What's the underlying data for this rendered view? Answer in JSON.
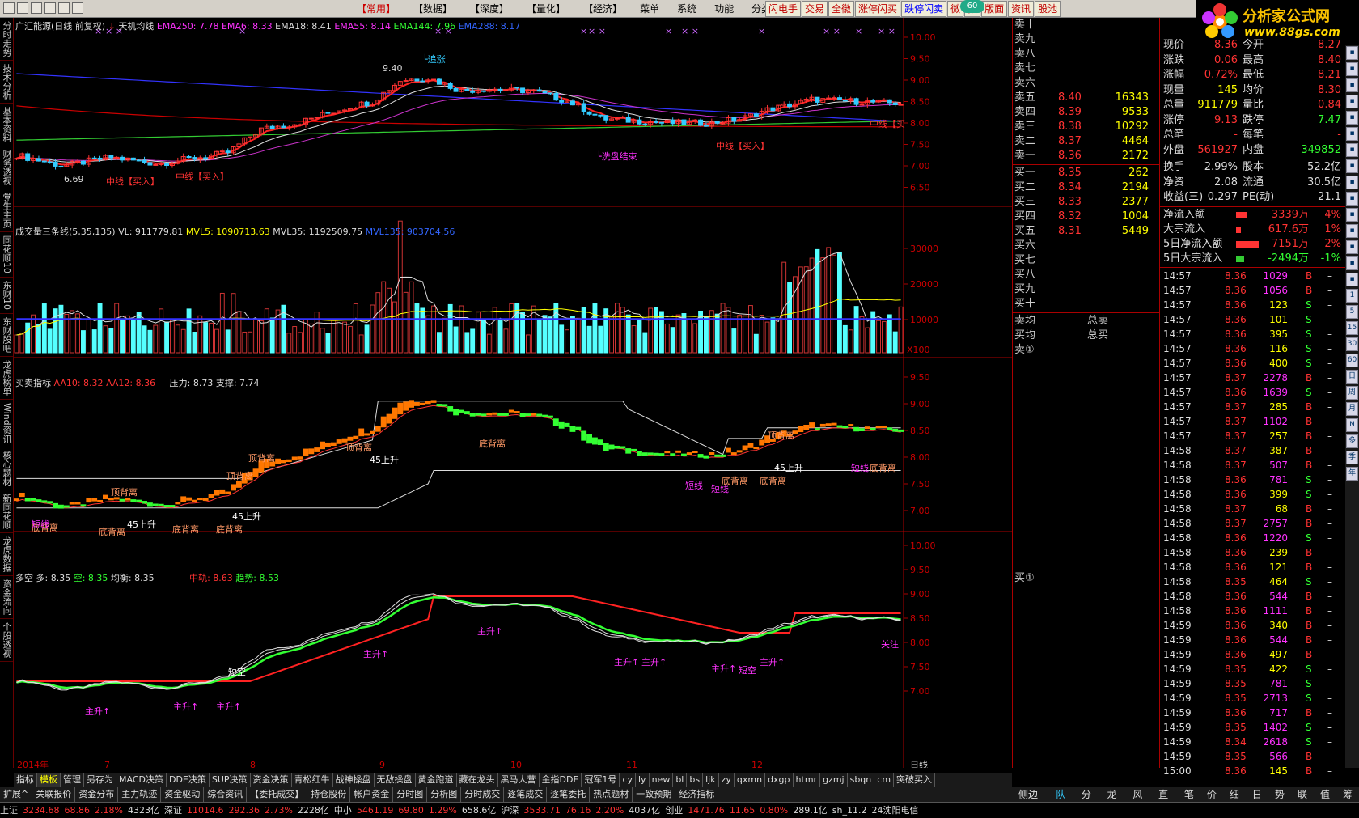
{
  "menus": [
    "【常用】",
    "【数据】",
    "【深度】",
    "【量化】",
    "【经济】",
    "菜单",
    "系统",
    "功能",
    "分类"
  ],
  "quick_buttons": [
    "闪电手",
    "交易",
    "全徽",
    "涨停闪买",
    "跌停闪卖",
    "微",
    "指",
    "版面",
    "资讯",
    "股池"
  ],
  "badge": "60",
  "logo": {
    "title": "分析家公式网",
    "url": "www.88gs.com"
  },
  "left_tabs": [
    "分时走势",
    "技术分析",
    "基本资料",
    "财务透视",
    "党生主页",
    "同花顺10",
    "东财10",
    "东财股吧",
    "龙虎榜单",
    "Wind资讯",
    "核心题材",
    "新同花顺",
    "龙虎数据",
    "资金流向",
    "个股透视"
  ],
  "panel1": {
    "stock": "广汇能源(日线 前复权)",
    "indicator": "天机均线",
    "ema250": "EMA250: 7.78",
    "ema6": "EMA6: 8.33",
    "ema18": "EMA18: 8.41",
    "ema55": "EMA55: 8.14",
    "ema144": "EMA144: 7.96",
    "ema288": "EMA288: 8.17",
    "yticks": [
      "10.00",
      "9.50",
      "9.00",
      "8.50",
      "8.00",
      "7.50",
      "7.00",
      "6.50"
    ],
    "ann": {
      "low": "6.69",
      "high": "9.40",
      "buy1": "中线【买入】",
      "buy2": "中线【买入】",
      "buy3": "中线【买入】",
      "buy4": "中线【买",
      "wash": "洗盘结束",
      "chase": "追涨"
    }
  },
  "panel2": {
    "title": "成交量三条线(5,35,135)",
    "vl": "VL: 911779.81",
    "mvl5": "MVL5: 1090713.63",
    "mvl35": "MVL35: 1192509.75",
    "mvl135": "MVL135: 903704.56",
    "yticks": [
      "30000",
      "20000",
      "10000"
    ],
    "unit": "X100"
  },
  "panel3": {
    "title": "买卖指标",
    "aa10": "AA10: 8.32",
    "aa12": "AA12: 8.36",
    "press": "压力: 8.73",
    "support": "支撑: 7.74",
    "yticks": [
      "9.50",
      "9.00",
      "8.50",
      "8.00",
      "7.50",
      "7.00"
    ],
    "labels": [
      "顶背离",
      "顶背离",
      "顶背离",
      "顶背离",
      "顶背离",
      "底背离",
      "底背离",
      "底背离",
      "底背离",
      "底背离",
      "底背离",
      "底背离",
      "底背离",
      "45上升",
      "45上升",
      "45上升",
      "45上升",
      "短线",
      "短线",
      "短线",
      "短线"
    ]
  },
  "panel4": {
    "title": "多空",
    "duo": "多: 8.35",
    "kong": "空: 8.35",
    "junheng": "均衡: 8.35",
    "zhongzhou": "中轨: 8.63",
    "qushi": "趋势: 8.53",
    "yticks": [
      "10.00",
      "9.50",
      "9.00",
      "8.50",
      "8.00",
      "7.50",
      "7.00"
    ],
    "labels": [
      "主升↑",
      "主升↑",
      "主升↑",
      "主升↑",
      "主升↑",
      "主升↑",
      "主升↑",
      "主升↑",
      "主升↑",
      "关注",
      "短空"
    ]
  },
  "xaxis": {
    "labels": [
      "2014年",
      "7",
      "8",
      "9",
      "10",
      "11",
      "12"
    ],
    "period": "日线"
  },
  "orderbook": {
    "asks": [
      {
        "l": "卖十",
        "p": "",
        "v": ""
      },
      {
        "l": "卖九",
        "p": "",
        "v": ""
      },
      {
        "l": "卖八",
        "p": "",
        "v": ""
      },
      {
        "l": "卖七",
        "p": "",
        "v": ""
      },
      {
        "l": "卖六",
        "p": "",
        "v": ""
      },
      {
        "l": "卖五",
        "p": "8.40",
        "v": "16343"
      },
      {
        "l": "卖四",
        "p": "8.39",
        "v": "9533"
      },
      {
        "l": "卖三",
        "p": "8.38",
        "v": "10292"
      },
      {
        "l": "卖二",
        "p": "8.37",
        "v": "4464"
      },
      {
        "l": "卖一",
        "p": "8.36",
        "v": "2172"
      }
    ],
    "bids": [
      {
        "l": "买一",
        "p": "8.35",
        "v": "262"
      },
      {
        "l": "买二",
        "p": "8.34",
        "v": "2194"
      },
      {
        "l": "买三",
        "p": "8.33",
        "v": "2377"
      },
      {
        "l": "买四",
        "p": "8.32",
        "v": "1004"
      },
      {
        "l": "买五",
        "p": "8.31",
        "v": "5449"
      },
      {
        "l": "买六",
        "p": "",
        "v": ""
      },
      {
        "l": "买七",
        "p": "",
        "v": ""
      },
      {
        "l": "买八",
        "p": "",
        "v": ""
      },
      {
        "l": "买九",
        "p": "",
        "v": ""
      },
      {
        "l": "买十",
        "p": "",
        "v": ""
      }
    ],
    "avg_sell": "卖均",
    "avg_buy": "买均",
    "total_sell": "总卖",
    "total_buy": "总买",
    "sell1": "卖①",
    "buy1": "买①"
  },
  "quote": [
    {
      "k1": "现价",
      "v1": "8.36",
      "k2": "今开",
      "v2": "8.27"
    },
    {
      "k1": "涨跌",
      "v1": "0.06",
      "k2": "最高",
      "v2": "8.40"
    },
    {
      "k1": "涨幅",
      "v1": "0.72%",
      "k2": "最低",
      "v2": "8.21"
    },
    {
      "k1": "现量",
      "v1": "145",
      "k2": "均价",
      "v2": "8.30"
    },
    {
      "k1": "总量",
      "v1": "911779",
      "k2": "量比",
      "v2": "0.84"
    },
    {
      "k1": "涨停",
      "v1": "9.13",
      "k2": "跌停",
      "v2": "7.47"
    },
    {
      "k1": "总笔",
      "v1": "-",
      "k2": "每笔",
      "v2": "-"
    },
    {
      "k1": "外盘",
      "v1": "561927",
      "k2": "内盘",
      "v2": "349852"
    },
    {
      "k1": "换手",
      "v1": "2.99%",
      "k2": "股本",
      "v2": "52.2亿"
    },
    {
      "k1": "净资",
      "v1": "2.08",
      "k2": "流通",
      "v2": "30.5亿"
    },
    {
      "k1": "收益(三)",
      "v1": "0.297",
      "k2": "PE(动)",
      "v2": "21.1"
    }
  ],
  "flows": [
    {
      "k": "净流入额",
      "v": "3339万",
      "p": "4%"
    },
    {
      "k": "大宗流入",
      "v": "617.6万",
      "p": "1%"
    },
    {
      "k": "5日净流入额",
      "v": "7151万",
      "p": "2%"
    },
    {
      "k": "5日大宗流入",
      "v": "-2494万",
      "p": "-1%"
    }
  ],
  "ticks": [
    [
      "14:57",
      "8.36",
      "1029",
      "B"
    ],
    [
      "14:57",
      "8.36",
      "1056",
      "B"
    ],
    [
      "14:57",
      "8.36",
      "123",
      "S"
    ],
    [
      "14:57",
      "8.36",
      "101",
      "S"
    ],
    [
      "14:57",
      "8.36",
      "395",
      "S"
    ],
    [
      "14:57",
      "8.36",
      "116",
      "S"
    ],
    [
      "14:57",
      "8.36",
      "400",
      "S"
    ],
    [
      "14:57",
      "8.37",
      "2278",
      "B"
    ],
    [
      "14:57",
      "8.36",
      "1639",
      "S"
    ],
    [
      "14:57",
      "8.37",
      "285",
      "B"
    ],
    [
      "14:57",
      "8.37",
      "1102",
      "B"
    ],
    [
      "14:57",
      "8.37",
      "257",
      "B"
    ],
    [
      "14:58",
      "8.37",
      "387",
      "B"
    ],
    [
      "14:58",
      "8.37",
      "507",
      "B"
    ],
    [
      "14:58",
      "8.36",
      "781",
      "S"
    ],
    [
      "14:58",
      "8.36",
      "399",
      "S"
    ],
    [
      "14:58",
      "8.37",
      "68",
      "B"
    ],
    [
      "14:58",
      "8.37",
      "2757",
      "B"
    ],
    [
      "14:58",
      "8.36",
      "1220",
      "S"
    ],
    [
      "14:58",
      "8.36",
      "239",
      "B"
    ],
    [
      "14:58",
      "8.36",
      "121",
      "B"
    ],
    [
      "14:58",
      "8.35",
      "464",
      "S"
    ],
    [
      "14:58",
      "8.36",
      "544",
      "B"
    ],
    [
      "14:58",
      "8.36",
      "1111",
      "B"
    ],
    [
      "14:59",
      "8.36",
      "340",
      "B"
    ],
    [
      "14:59",
      "8.36",
      "544",
      "B"
    ],
    [
      "14:59",
      "8.36",
      "497",
      "B"
    ],
    [
      "14:59",
      "8.35",
      "422",
      "S"
    ],
    [
      "14:59",
      "8.35",
      "781",
      "S"
    ],
    [
      "14:59",
      "8.35",
      "2713",
      "S"
    ],
    [
      "14:59",
      "8.36",
      "717",
      "B"
    ],
    [
      "14:59",
      "8.35",
      "1402",
      "S"
    ],
    [
      "14:59",
      "8.34",
      "2618",
      "S"
    ],
    [
      "14:59",
      "8.35",
      "566",
      "B"
    ],
    [
      "15:00",
      "8.36",
      "145",
      "B"
    ]
  ],
  "icons": [
    "up-icon",
    "down-icon",
    "list-icon",
    "grid-icon",
    "chart-icon",
    "fin-icon",
    "money-icon",
    "bar-icon",
    "f10-icon",
    "calc-icon",
    "rsi-icon",
    "dollar-icon",
    "move-icon",
    "pen-icon",
    "f5-icon",
    "1",
    "5",
    "15",
    "30",
    "60",
    "日",
    "周",
    "月",
    "N",
    "多",
    "季",
    "年"
  ],
  "tabs1": [
    "指标",
    "模板",
    "管理",
    "另存为",
    "MACD决策",
    "DDE决策",
    "SUP决策",
    "资金决策",
    "青松红牛",
    "战神操盘",
    "无敌操盘",
    "黄金跑道",
    "藏在龙头",
    "黑马大营",
    "金指DDE",
    "冠军1号",
    "cy",
    "ly",
    "new",
    "bl",
    "bs",
    "ljk",
    "zy",
    "qxmn",
    "dxgp",
    "htmr",
    "gzmj",
    "sbqn",
    "cm",
    "突破买入"
  ],
  "tabs2": [
    "扩展^",
    "关联报价",
    "资金分布",
    "主力轨迹",
    "资金驱动",
    "综合资讯",
    "【委托成交】",
    "持仓股份",
    "帐户资金",
    "分时图",
    "分析图",
    "分时成交",
    "逐笔成交",
    "逐笔委托",
    "热点题材",
    "一致预期",
    "经济指标"
  ],
  "rtabs": [
    "侧边栏<",
    "队列",
    "分布",
    "龙虎",
    "风向",
    "直播",
    "笔",
    "价",
    "细",
    "日",
    "势",
    "联",
    "值",
    "筹"
  ],
  "status": [
    {
      "t": "上证",
      "c": "w"
    },
    {
      "t": "3234.68",
      "c": "r"
    },
    {
      "t": "68.86",
      "c": "r"
    },
    {
      "t": "2.18%",
      "c": "r"
    },
    {
      "t": "4323亿",
      "c": "w"
    },
    {
      "t": "深证",
      "c": "w"
    },
    {
      "t": "11014.6",
      "c": "r"
    },
    {
      "t": "292.36",
      "c": "r"
    },
    {
      "t": "2.73%",
      "c": "r"
    },
    {
      "t": "2228亿",
      "c": "w"
    },
    {
      "t": "中小",
      "c": "w"
    },
    {
      "t": "5461.19",
      "c": "r"
    },
    {
      "t": "69.80",
      "c": "r"
    },
    {
      "t": "1.29%",
      "c": "r"
    },
    {
      "t": "658.6亿",
      "c": "w"
    },
    {
      "t": "沪深",
      "c": "w"
    },
    {
      "t": "3533.71",
      "c": "r"
    },
    {
      "t": "76.16",
      "c": "r"
    },
    {
      "t": "2.20%",
      "c": "r"
    },
    {
      "t": "4037亿",
      "c": "w"
    },
    {
      "t": "创业",
      "c": "w"
    },
    {
      "t": "1471.76",
      "c": "r"
    },
    {
      "t": "11.65",
      "c": "r"
    },
    {
      "t": "0.80%",
      "c": "r"
    },
    {
      "t": "289.1亿",
      "c": "w"
    },
    {
      "t": "sh_11.2",
      "c": "w"
    },
    {
      "t": "24沈阳电信",
      "c": "w"
    }
  ]
}
